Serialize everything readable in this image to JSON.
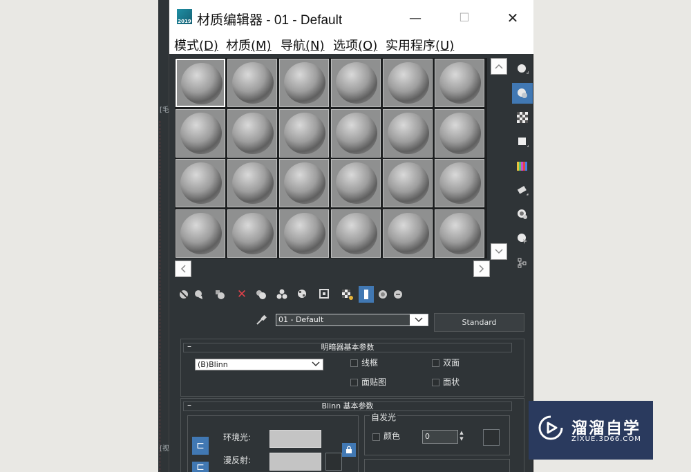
{
  "window": {
    "title": "材质编辑器 - 01 - Default",
    "app_icon_text": "2019",
    "minimize": "—",
    "maximize": "☐",
    "close": "✕"
  },
  "menu": [
    {
      "label": "模式",
      "key": "(D)"
    },
    {
      "label": "材质",
      "key": "(M)"
    },
    {
      "label": "导航",
      "key": "(N)"
    },
    {
      "label": "选项",
      "key": "(O)"
    },
    {
      "label": "实用程序",
      "key": "(U)"
    }
  ],
  "sample_slots": {
    "rows": 4,
    "cols": 6,
    "selected_index": 0
  },
  "side_tools": [
    "sphere-icon",
    "backlight-icon",
    "checker-background-icon",
    "sample-uv-tiling-icon",
    "video-color-check-icon",
    "make-preview-icon",
    "options-icon",
    "select-by-material-icon",
    "material-map-navigator-icon"
  ],
  "bottom_toolbar": [
    "get-material-icon",
    "put-to-scene-icon",
    "assign-material-icon",
    "reset-map-icon",
    "make-copy-icon",
    "make-unique-icon",
    "put-to-library-icon",
    "material-id-icon",
    "show-map-icon",
    "show-end-result-icon",
    "go-to-parent-icon",
    "go-forward-sibling-icon"
  ],
  "material": {
    "name": "01 - Default",
    "type": "Standard"
  },
  "shader_rollout": {
    "title": "明暗器基本参数",
    "collapse": "–",
    "shader": "(B)Blinn",
    "wire": "线框",
    "two_sided": "双面",
    "face_map": "面贴图",
    "faceted": "面状"
  },
  "blinn_rollout": {
    "title": "Blinn 基本参数",
    "collapse": "–",
    "ambient": "环境光:",
    "diffuse": "漫反射:",
    "self_illum_title": "自发光",
    "color_label": "颜色",
    "self_illum_value": "0"
  },
  "watermark": {
    "title": "溜溜自学",
    "subtitle": "ZIXUE.3D66.COM"
  },
  "left_strip": {
    "mark1": "[毛",
    "mark2": "[视"
  }
}
